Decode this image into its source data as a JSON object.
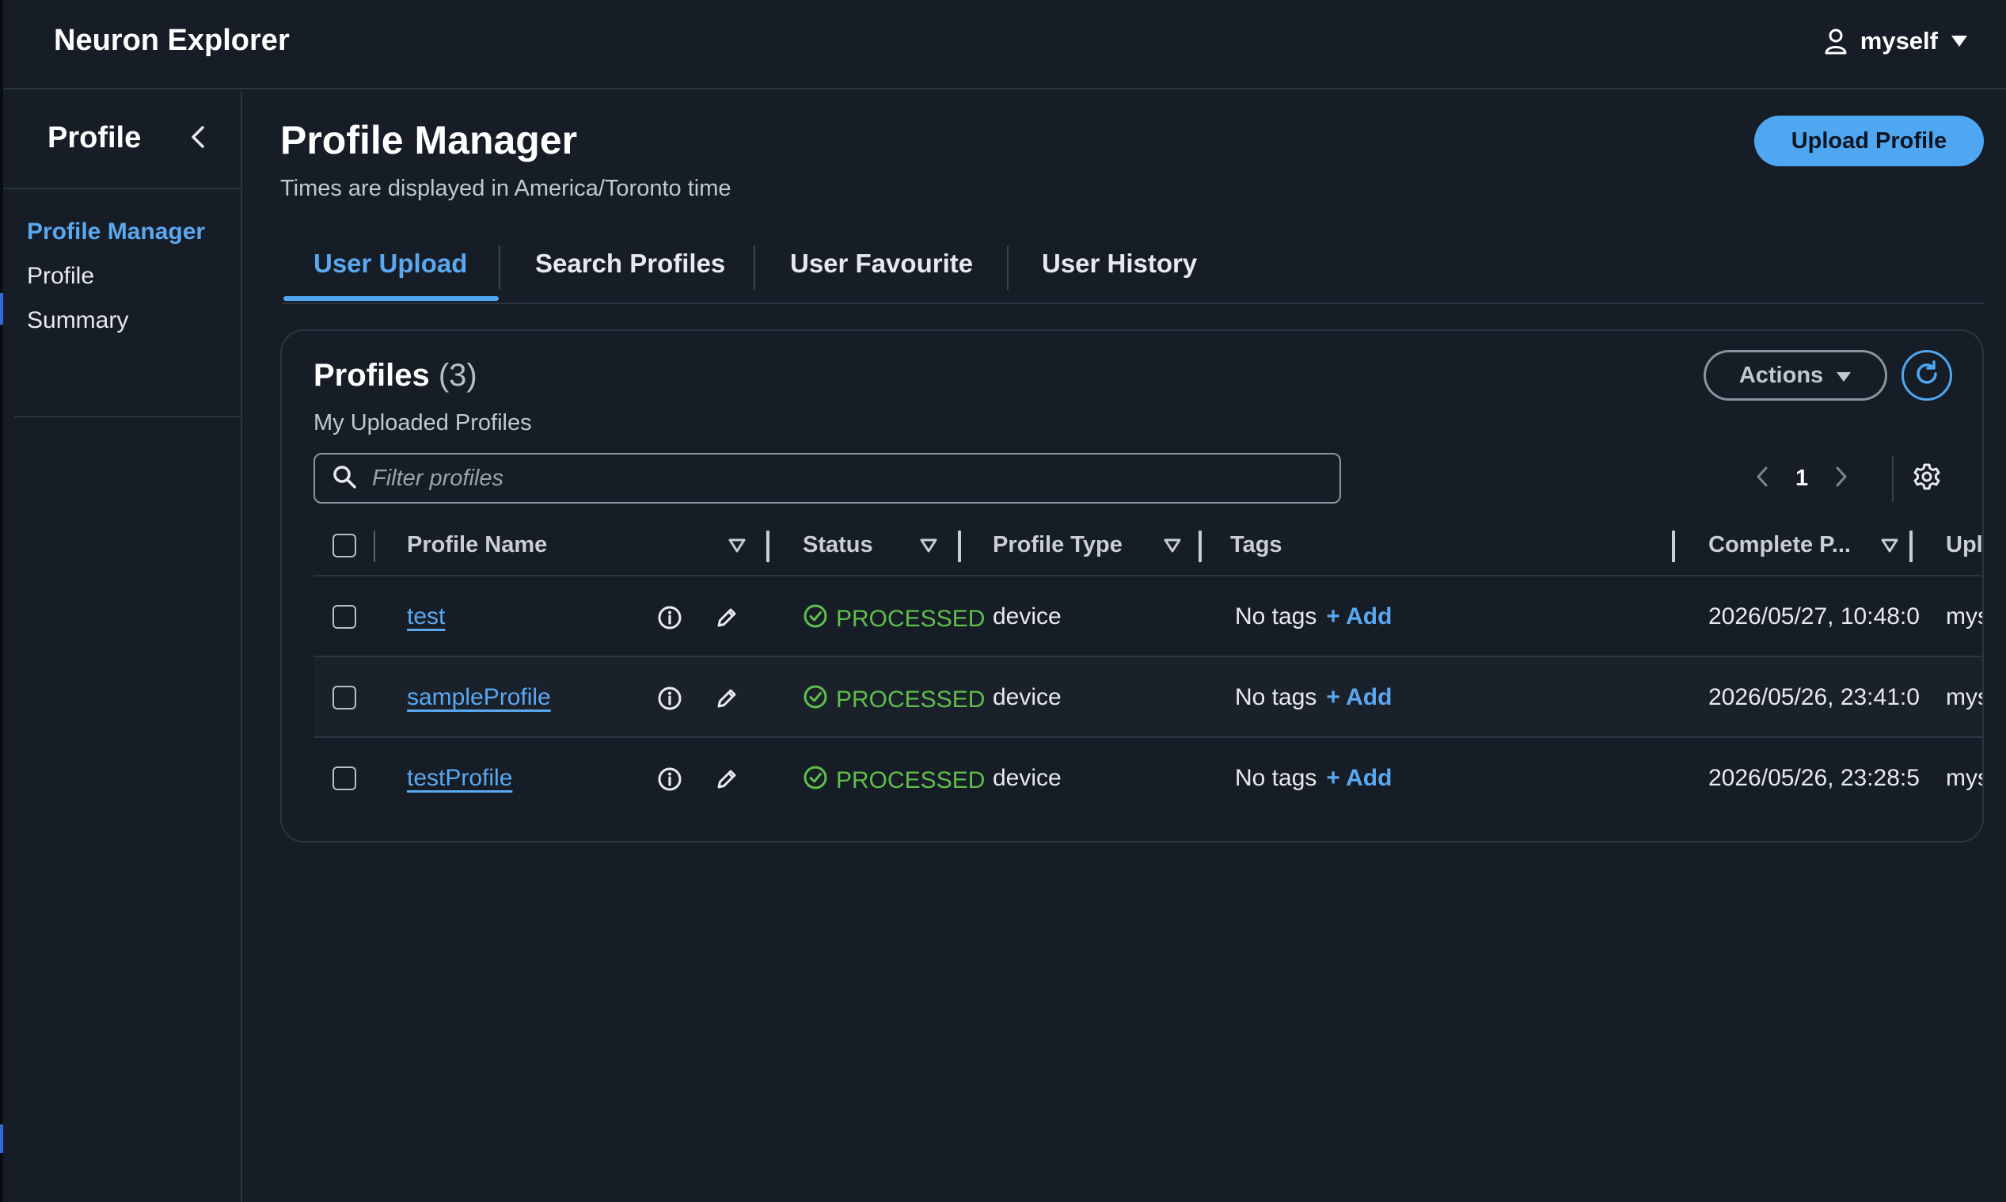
{
  "app": {
    "title": "Neuron Explorer"
  },
  "user_menu": {
    "username": "myself"
  },
  "sidebar": {
    "title": "Profile",
    "items": [
      {
        "label": "Profile Manager",
        "active": true
      },
      {
        "label": "Profile",
        "active": false
      },
      {
        "label": "Summary",
        "active": false
      }
    ]
  },
  "page": {
    "title": "Profile Manager",
    "subtitle": "Times are displayed in America/Toronto time",
    "upload_button": "Upload Profile"
  },
  "tabs": [
    {
      "label": "User Upload",
      "active": true
    },
    {
      "label": "Search Profiles",
      "active": false
    },
    {
      "label": "User Favourite",
      "active": false
    },
    {
      "label": "User History",
      "active": false
    }
  ],
  "panel": {
    "title": "Profiles",
    "count": "(3)",
    "subtitle": "My Uploaded Profiles",
    "actions_label": "Actions",
    "search_placeholder": "Filter profiles",
    "current_page": "1"
  },
  "table": {
    "columns": {
      "name": "Profile Name",
      "status": "Status",
      "type": "Profile Type",
      "tags": "Tags",
      "complete": "Complete P...",
      "uploader": "Upl"
    },
    "rows": [
      {
        "name": "test",
        "status": "PROCESSED",
        "type": "device",
        "tags": "No tags",
        "add": "+ Add",
        "complete": "2026/05/27, 10:48:0",
        "uploader": "myself"
      },
      {
        "name": "sampleProfile",
        "status": "PROCESSED",
        "type": "device",
        "tags": "No tags",
        "add": "+ Add",
        "complete": "2026/05/26, 23:41:0",
        "uploader": "myself"
      },
      {
        "name": "testProfile",
        "status": "PROCESSED",
        "type": "device",
        "tags": "No tags",
        "add": "+ Add",
        "complete": "2026/05/26, 23:28:5",
        "uploader": "myself"
      }
    ]
  },
  "colors": {
    "accent": "#4fa7f2",
    "success": "#5fbf4a",
    "background": "#161d26"
  },
  "icons": [
    "user-icon",
    "chevron-down-icon",
    "chevron-left-icon",
    "refresh-icon",
    "search-icon",
    "chevron-right-icon",
    "gear-icon",
    "filter-icon",
    "info-icon",
    "pencil-icon",
    "check-circle-icon"
  ]
}
